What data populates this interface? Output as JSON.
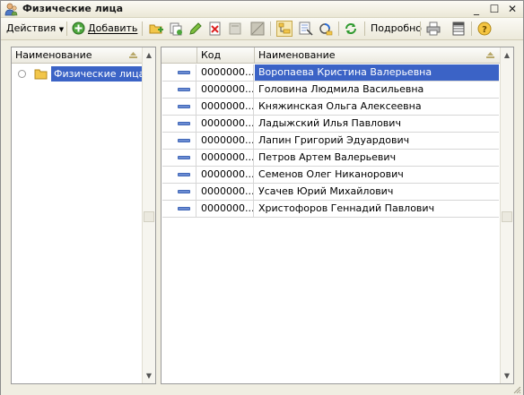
{
  "window": {
    "title": "Физические лица",
    "minimize_glyph": "_",
    "maximize_glyph": "☐",
    "close_glyph": "✕"
  },
  "toolbar": {
    "actions_label": "Действия",
    "add_label": "Добавить",
    "details_label": "Подробно",
    "icons": [
      "add-folder-icon",
      "copy-icon",
      "edit-pencil-icon",
      "delete-icon",
      "mark-deletion-icon",
      "hierarchy-icon",
      "tree-view-icon",
      "find-icon",
      "set-filter-icon",
      "refresh-icon",
      "print-icon",
      "list-settings-icon",
      "help-icon"
    ]
  },
  "tree": {
    "column_header": "Наименование",
    "items": [
      {
        "label": "Физические лица",
        "selected": true
      }
    ]
  },
  "list": {
    "columns": [
      "",
      "Код",
      "Наименование"
    ],
    "rows": [
      {
        "code": "0000000...",
        "name": "Воропаева Кристина Валерьевна",
        "selected": true
      },
      {
        "code": "0000000...",
        "name": "Головина Людмила Васильевна"
      },
      {
        "code": "0000000...",
        "name": "Княжинская Ольга Алексеевна"
      },
      {
        "code": "0000000...",
        "name": "Ладыжский Илья Павлович"
      },
      {
        "code": "0000000...",
        "name": "Лапин Григорий Эдуардович"
      },
      {
        "code": "0000000...",
        "name": "Петров Артем Валерьевич"
      },
      {
        "code": "0000000...",
        "name": "Семенов Олег Никанорович"
      },
      {
        "code": "0000000...",
        "name": "Усачев Юрий Михайлович"
      },
      {
        "code": "0000000...",
        "name": "Христофоров Геннадий Павлович"
      }
    ]
  },
  "colors": {
    "selection": "#3b63c6",
    "window_bg": "#f0eee2"
  }
}
